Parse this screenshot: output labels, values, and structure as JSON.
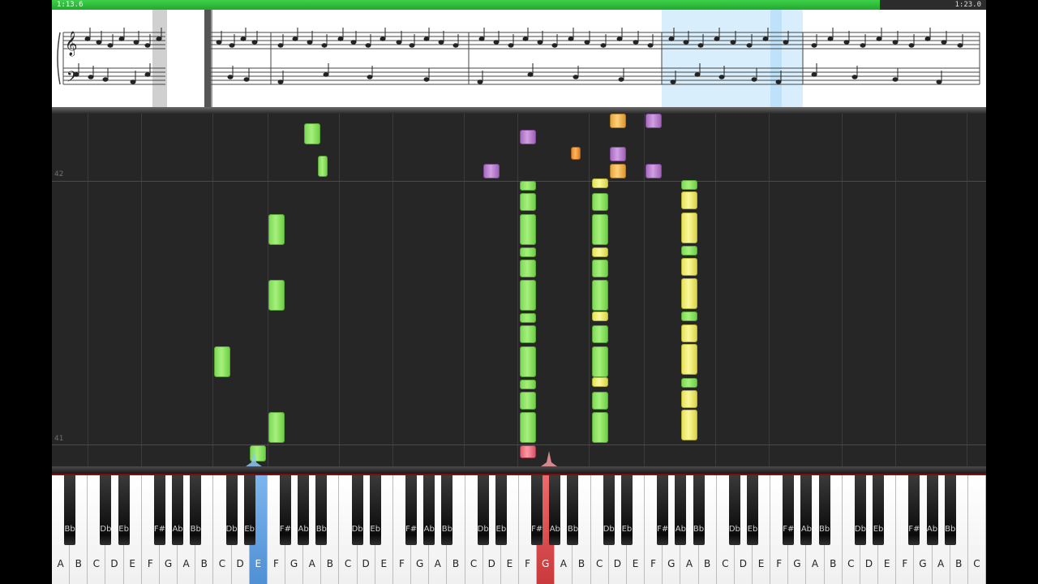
{
  "player": {
    "current_time": "1:13.6",
    "total_time": "1:23.0",
    "progress_fraction": 0.886
  },
  "field": {
    "measure_labels": [
      "42",
      "41"
    ]
  },
  "colors": {
    "progress": "#2fbf3a",
    "background": "#262626",
    "green_note": "#8ee563",
    "yellow_note": "#f2ef7a",
    "purple_note": "#b983cf",
    "orange_note": "#f39a3a",
    "pressed_blue": "#5d9ee0",
    "pressed_red": "#e0474e"
  },
  "keyboard": {
    "white_keys": [
      "A",
      "B",
      "C",
      "D",
      "E",
      "F",
      "G",
      "A",
      "B",
      "C",
      "D",
      "E",
      "F",
      "G",
      "A",
      "B",
      "C",
      "D",
      "E",
      "F",
      "G",
      "A",
      "B",
      "C",
      "D",
      "E",
      "F",
      "G",
      "A",
      "B",
      "C",
      "D",
      "E",
      "F",
      "G",
      "A",
      "B",
      "C",
      "D",
      "E",
      "F",
      "G",
      "A",
      "B",
      "C",
      "D",
      "E",
      "F",
      "G",
      "A",
      "B",
      "C"
    ],
    "black_pattern": [
      "Bb",
      "",
      "Db",
      "Eb",
      "",
      "F#",
      "Ab"
    ],
    "pressed": [
      {
        "white_index": 11,
        "label": "E",
        "color": "blue"
      },
      {
        "white_index": 27,
        "label": "G",
        "color": "red"
      }
    ]
  }
}
